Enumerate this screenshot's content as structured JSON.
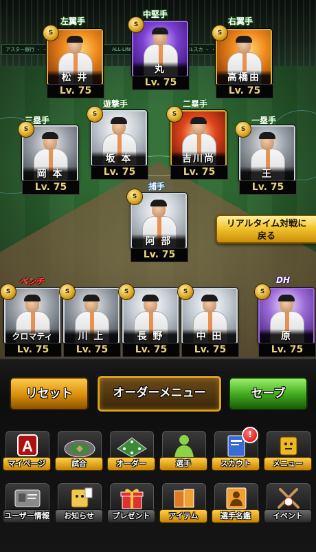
{
  "stadium": {
    "boards": [
      "アスター銀行 ・ ・ ・",
      "ALL-LINEUP",
      "ビッグルスカ ・ ・ ・ ・"
    ]
  },
  "lineup": [
    {
      "id": "lf",
      "position": "左翼手",
      "name": "松 井",
      "level": "Lv. 75",
      "rarity": "S",
      "icon": "batter-swing-portrait"
    },
    {
      "id": "cf",
      "position": "中堅手",
      "name": "丸",
      "level": "Lv. 75",
      "rarity": "S",
      "icon": "batter-cap-portrait"
    },
    {
      "id": "rf",
      "position": "右翼手",
      "name": "高橋由",
      "level": "Lv. 75",
      "rarity": "S",
      "icon": "batter-swing-portrait"
    },
    {
      "id": "3b",
      "position": "三塁手",
      "name": "岡 本",
      "level": "Lv. 75",
      "rarity": "S",
      "icon": "batter-helmet-portrait"
    },
    {
      "id": "ss",
      "position": "遊撃手",
      "name": "坂 本",
      "level": "Lv. 75",
      "rarity": "S",
      "icon": "batter-cap-portrait"
    },
    {
      "id": "2b",
      "position": "二塁手",
      "name": "吉川尚",
      "level": "Lv. 75",
      "rarity": "S",
      "icon": "fielder-throw-portrait"
    },
    {
      "id": "1b",
      "position": "一塁手",
      "name": "王",
      "level": "Lv. 75",
      "rarity": "S",
      "icon": "batter-classic-portrait"
    },
    {
      "id": "c",
      "position": "捕手",
      "name": "阿 部",
      "level": "Lv. 75",
      "rarity": "S",
      "icon": "catcher-portrait"
    }
  ],
  "bench": {
    "label": "ベンチ",
    "players": [
      {
        "name": "クロマティ",
        "level": "Lv. 75",
        "rarity": "S",
        "icon": "batter-classic-portrait"
      },
      {
        "name": "川 上",
        "level": "Lv. 75",
        "rarity": "S",
        "icon": "batter-classic-portrait"
      },
      {
        "name": "長 野",
        "level": "Lv. 75",
        "rarity": "S",
        "icon": "batter-helmet-portrait"
      }
    ]
  },
  "starters_extra": [
    {
      "name": "中 田",
      "level": "Lv. 75",
      "rarity": "S",
      "icon": "batter-cap-portrait"
    }
  ],
  "dh": {
    "label": "DH",
    "name": "原",
    "level": "Lv. 75",
    "rarity": "S",
    "icon": "batter-cap-portrait"
  },
  "realtime": {
    "line1": "リアルタイム対戦に",
    "line2": "戻る"
  },
  "actions": {
    "reset": "リセット",
    "order_menu": "オーダーメニュー",
    "save": "セーブ"
  },
  "menu_row1": [
    {
      "label": "マイページ",
      "icon": "mypage-a-icon"
    },
    {
      "label": "試合",
      "icon": "stadium-icon"
    },
    {
      "label": "オーダー",
      "icon": "field-formation-icon"
    },
    {
      "label": "選手",
      "icon": "player-silhouette-icon"
    },
    {
      "label": "スカウト",
      "icon": "scout-book-icon",
      "notification": "!"
    },
    {
      "label": "メニュー",
      "icon": "menu-box-character-icon"
    }
  ],
  "menu_row2": [
    {
      "label": "ユーザー情報",
      "icon": "user-card-icon"
    },
    {
      "label": "お知らせ",
      "icon": "news-box-character-icon"
    },
    {
      "label": "プレゼント",
      "icon": "gift-box-icon"
    },
    {
      "label": "アイテム",
      "icon": "item-books-icon"
    },
    {
      "label": "選手名鑑",
      "icon": "player-book-icon"
    },
    {
      "label": "イベント",
      "icon": "bats-ball-icon"
    }
  ]
}
